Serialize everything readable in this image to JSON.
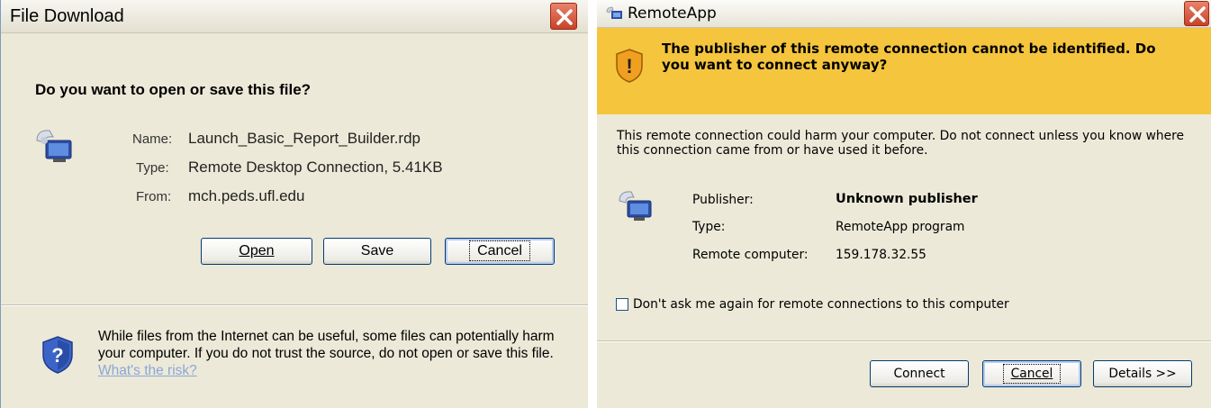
{
  "file_download": {
    "title": "File Download",
    "question": "Do you want to open or save this file?",
    "name_label": "Name:",
    "name_value": "Launch_Basic_Report_Builder.rdp",
    "type_label": "Type:",
    "type_value": "Remote Desktop Connection, 5.41KB",
    "from_label": "From:",
    "from_value": "mch.peds.ufl.edu",
    "open_label": "Open",
    "save_label": "Save",
    "cancel_label": "Cancel",
    "warning_text": "While files from the Internet can be useful, some files can potentially harm your computer. If you do not trust the source, do not open or save this file.",
    "risk_link": "What's the risk?"
  },
  "remoteapp": {
    "title": "RemoteApp",
    "banner_text": "The publisher of this remote connection cannot be identified. Do you want to connect anyway?",
    "description": "This remote connection could harm your computer. Do not connect unless you know where this connection came from or have used it before.",
    "publisher_label": "Publisher:",
    "publisher_value": "Unknown publisher",
    "type_label": "Type:",
    "type_value": "RemoteApp program",
    "remote_label": "Remote computer:",
    "remote_value": "159.178.32.55",
    "checkbox_label": "Don't ask me again for remote connections to this computer",
    "connect_label": "Connect",
    "cancel_label": "Cancel",
    "details_label": "Details >>"
  },
  "colors": {
    "banner": "#f5c53d",
    "link": "#8aa7d6",
    "close_button": "#d35a3e"
  },
  "icons": [
    "close-icon",
    "remote-desktop-icon",
    "shield-question-icon",
    "warning-shield-icon",
    "remoteapp-icon",
    "checkbox-icon"
  ]
}
